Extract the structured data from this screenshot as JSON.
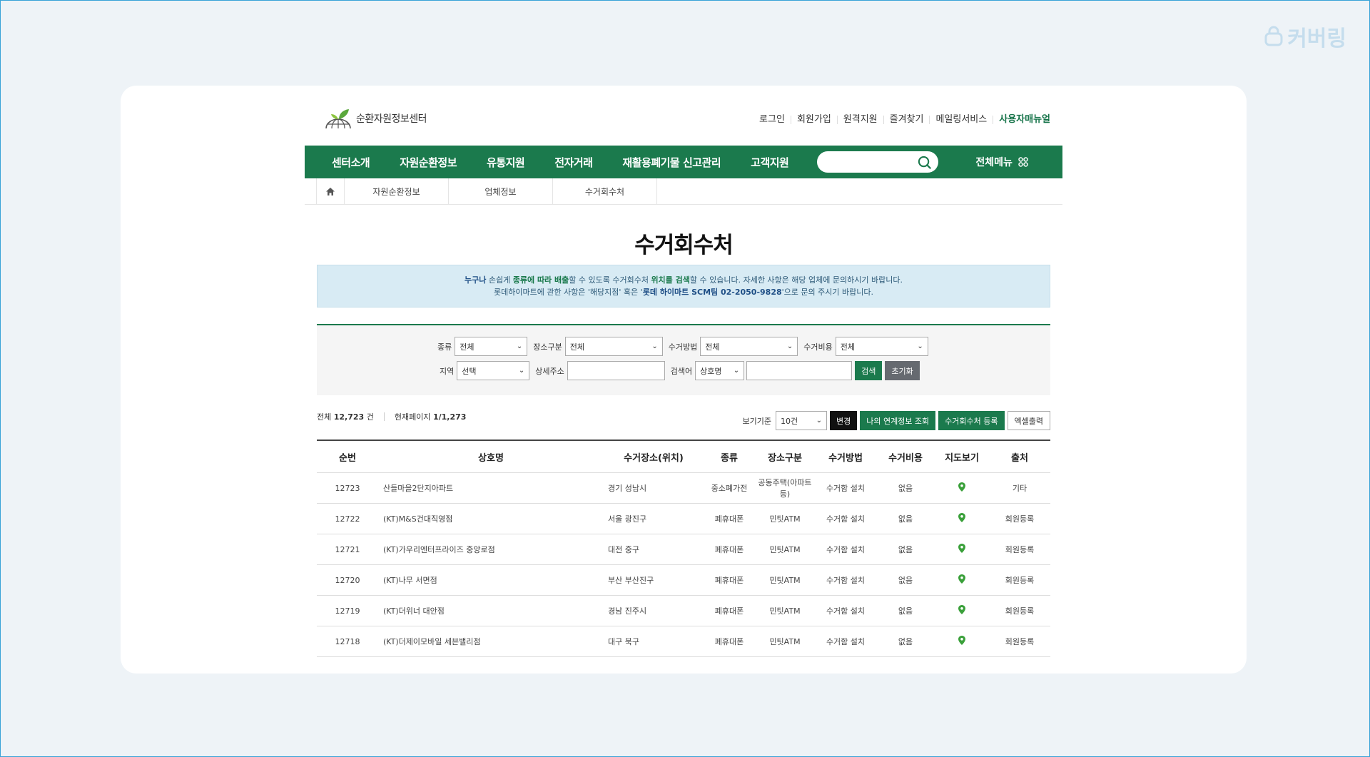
{
  "watermark": "커버링",
  "logo": {
    "text": "순환자원정보센터"
  },
  "top_links": [
    "로그인",
    "회원가입",
    "원격지원",
    "즐겨찾기",
    "메일링서비스",
    "사용자매뉴얼"
  ],
  "nav": {
    "items": [
      "센터소개",
      "자원순환정보",
      "유통지원",
      "전자거래",
      "재활용폐기물 신고관리",
      "고객지원"
    ],
    "search_placeholder": "",
    "all_menu": "전체메뉴"
  },
  "breadcrumb": [
    "자원순환정보",
    "업체정보",
    "수거회수처"
  ],
  "page_title": "수거회수처",
  "notice": {
    "line1_a": "누구나",
    "line1_b": " 손쉽게 ",
    "line1_c": "종류에 따라 배출",
    "line1_d": "할 수 있도록 수거회수처 ",
    "line1_e": "위치를 검색",
    "line1_f": "할 수 있습니다. 자세한 사항은 해당 업체에 문의하시기 바랍니다.",
    "line2_a": "롯데하이마트에 관한 사항은 '해당지점' 혹은 '",
    "line2_b": "롯데 하이마트 SCM팀 02-2050-9828",
    "line2_c": "'으로 문의 주시기 바랍니다."
  },
  "filters": {
    "type_label": "종류",
    "type_value": "전체",
    "place_label": "장소구분",
    "place_value": "전체",
    "method_label": "수거방법",
    "method_value": "전체",
    "cost_label": "수거비용",
    "cost_value": "전체",
    "region_label": "지역",
    "region_value": "선택",
    "address_label": "상세주소",
    "address_value": "",
    "keyword_label": "검색어",
    "keyword_field": "상호명",
    "keyword_value": "",
    "search_button": "검색",
    "reset_button": "초기화"
  },
  "summary": {
    "total_label": "전체",
    "total_value": "12,723",
    "total_unit": "건",
    "page_label": "현재페이지",
    "page_value": "1/1,273"
  },
  "actions": {
    "view_label": "보기기준",
    "view_value": "10건",
    "change_button": "변경",
    "link_button": "나의 연계정보 조회",
    "register_button": "수거회수처 등록",
    "excel_button": "엑셀출력"
  },
  "table": {
    "headers": [
      "순번",
      "상호명",
      "수거장소(위치)",
      "종류",
      "장소구분",
      "수거방법",
      "수거비용",
      "지도보기",
      "출처"
    ],
    "rows": [
      [
        "12723",
        "산들마을2단지아파트",
        "경기 성남시",
        "중소폐가전",
        "공동주택(아파트등)",
        "수거함 설치",
        "없음",
        "기타"
      ],
      [
        "12722",
        "(KT)M&S건대직영점",
        "서울 광진구",
        "폐휴대폰",
        "민팃ATM",
        "수거함 설치",
        "없음",
        "회원등록"
      ],
      [
        "12721",
        "(KT)가우리엔터프라이즈 중앙로점",
        "대전 중구",
        "폐휴대폰",
        "민팃ATM",
        "수거함 설치",
        "없음",
        "회원등록"
      ],
      [
        "12720",
        "(KT)나무 서면점",
        "부산 부산진구",
        "폐휴대폰",
        "민팃ATM",
        "수거함 설치",
        "없음",
        "회원등록"
      ],
      [
        "12719",
        "(KT)더위너 대안점",
        "경남 진주시",
        "폐휴대폰",
        "민팃ATM",
        "수거함 설치",
        "없음",
        "회원등록"
      ],
      [
        "12718",
        "(KT)더제이모바일 세븐밸리점",
        "대구 북구",
        "폐휴대폰",
        "민팃ATM",
        "수거함 설치",
        "없음",
        "회원등록"
      ]
    ]
  },
  "colors": {
    "brand_green": "#1b7a4d",
    "notice_bg": "#d8ebf4",
    "pin_green": "#3aa03a"
  }
}
